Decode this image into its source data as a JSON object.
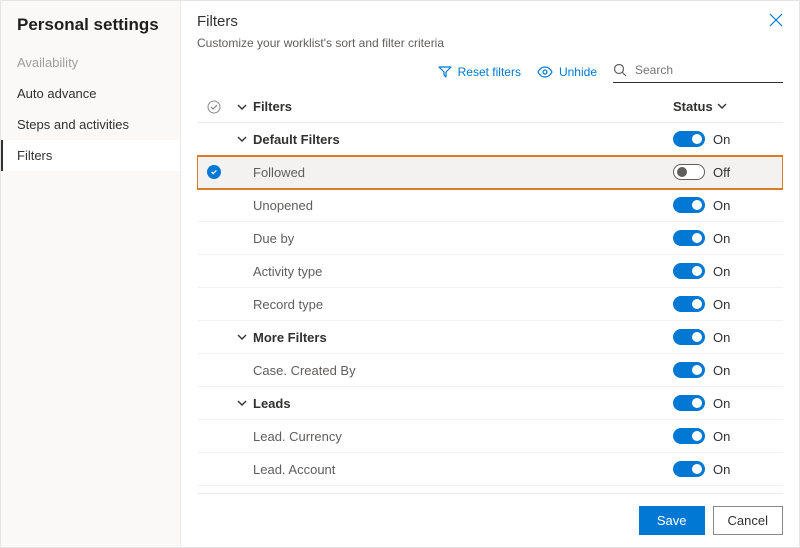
{
  "sidebar": {
    "title": "Personal settings",
    "items": [
      {
        "label": "Availability",
        "active": false,
        "disabled": true
      },
      {
        "label": "Auto advance",
        "active": false,
        "disabled": false
      },
      {
        "label": "Steps and activities",
        "active": false,
        "disabled": false
      },
      {
        "label": "Filters",
        "active": true,
        "disabled": false
      }
    ]
  },
  "page": {
    "title": "Filters",
    "subtitle": "Customize your worklist's sort and filter criteria"
  },
  "actions": {
    "reset": "Reset filters",
    "unhide": "Unhide",
    "search_placeholder": "Search"
  },
  "columns": {
    "name": "Filters",
    "status": "Status"
  },
  "status_labels": {
    "on": "On",
    "off": "Off"
  },
  "rows": [
    {
      "type": "group",
      "label": "Default Filters",
      "on": true,
      "selected": false,
      "expanded": true,
      "highlight": false
    },
    {
      "type": "child",
      "label": "Followed",
      "on": false,
      "selected": true,
      "highlight": true
    },
    {
      "type": "child",
      "label": "Unopened",
      "on": true,
      "selected": false,
      "highlight": false
    },
    {
      "type": "child",
      "label": "Due by",
      "on": true,
      "selected": false,
      "highlight": false
    },
    {
      "type": "child",
      "label": "Activity type",
      "on": true,
      "selected": false,
      "highlight": false
    },
    {
      "type": "child",
      "label": "Record type",
      "on": true,
      "selected": false,
      "highlight": false
    },
    {
      "type": "group",
      "label": "More Filters",
      "on": true,
      "selected": false,
      "expanded": true,
      "highlight": false
    },
    {
      "type": "child",
      "label": "Case. Created By",
      "on": true,
      "selected": false,
      "highlight": false
    },
    {
      "type": "group",
      "label": "Leads",
      "on": true,
      "selected": false,
      "expanded": true,
      "highlight": false
    },
    {
      "type": "child",
      "label": "Lead. Currency",
      "on": true,
      "selected": false,
      "highlight": false
    },
    {
      "type": "child",
      "label": "Lead. Account",
      "on": true,
      "selected": false,
      "highlight": false
    }
  ],
  "footer": {
    "save": "Save",
    "cancel": "Cancel"
  }
}
